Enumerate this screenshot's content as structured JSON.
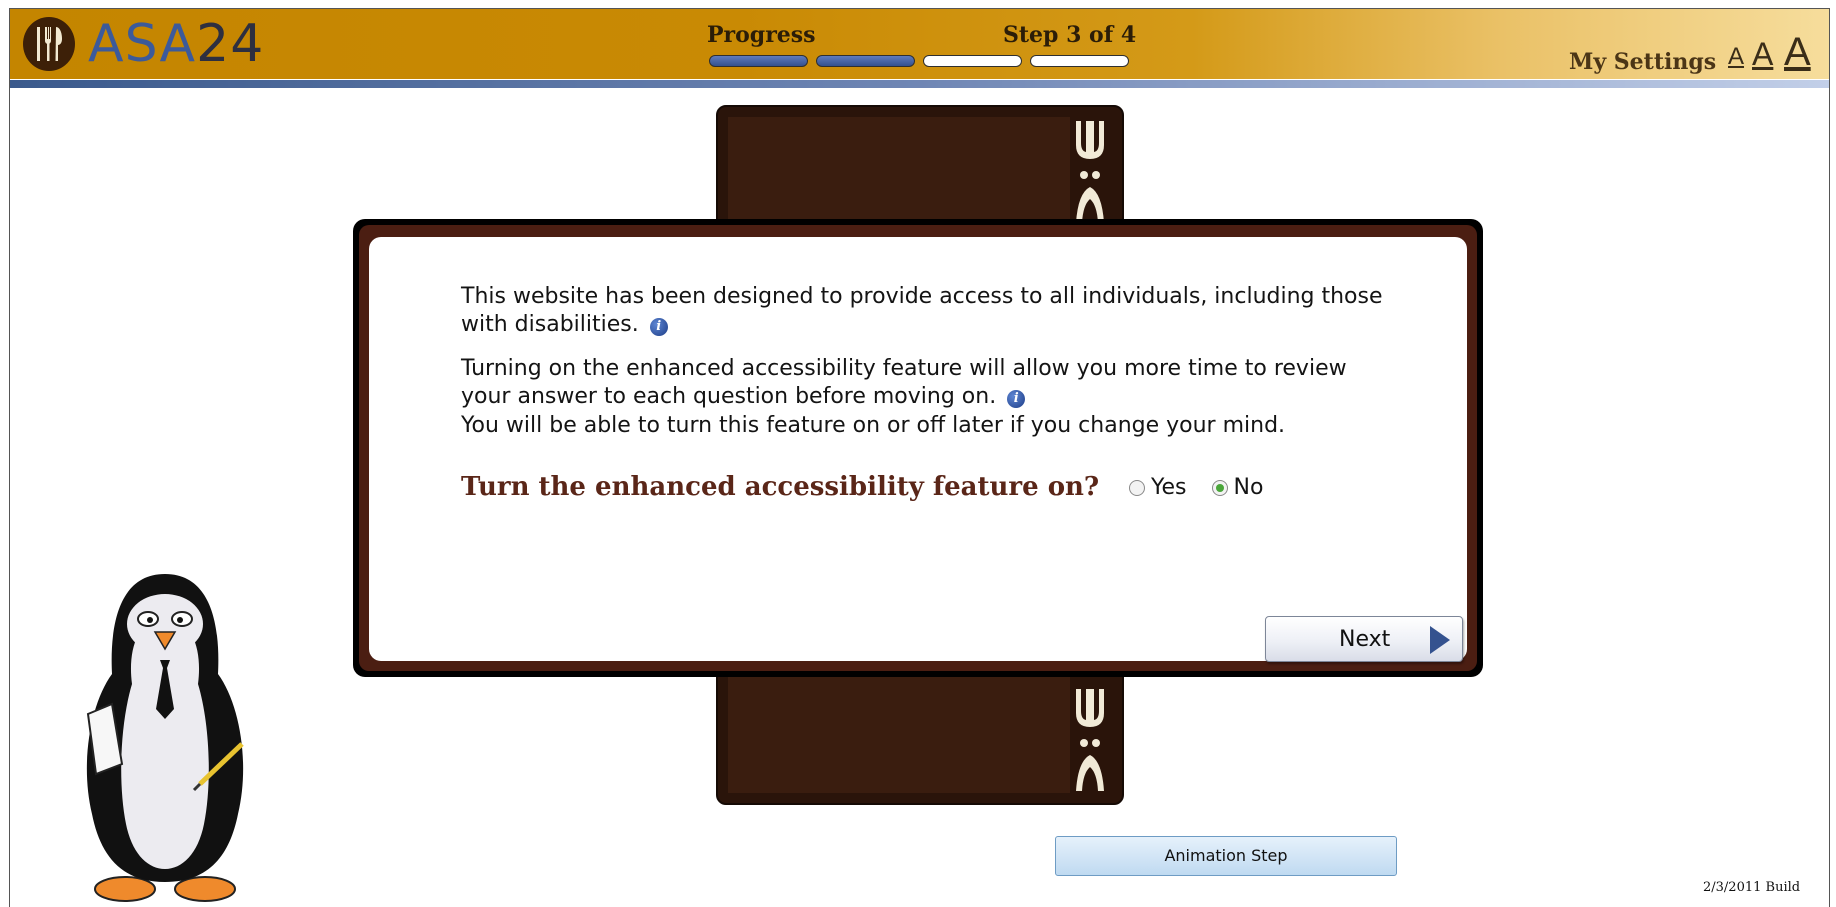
{
  "header": {
    "logo_letters": "ASA",
    "logo_number": "24",
    "progress_label": "Progress",
    "step_label": "Step 3 of 4",
    "progress": {
      "completed_steps": 2,
      "total_steps": 4
    },
    "my_settings_label": "My Settings",
    "font_size_options": [
      "A",
      "A",
      "A"
    ]
  },
  "dialog": {
    "paragraph1": "This website has been designed to provide access to all individuals, including those with disabilities.",
    "paragraph2": "Turning on the enhanced accessibility feature will allow you more time to review your answer to each question before moving on.",
    "paragraph3": "You will be able to turn this feature on or off later if you change your mind.",
    "question": "Turn the enhanced accessibility feature on?",
    "options": [
      {
        "label": "Yes",
        "selected": false
      },
      {
        "label": "No",
        "selected": true
      }
    ],
    "next_label": "Next"
  },
  "animation_button_label": "Animation Step",
  "build_label": "2/3/2011 Build",
  "colors": {
    "header_gold": "#c48500",
    "stripe_blue": "#3b5a8c",
    "placemat_brown": "#2a140a",
    "question_brown": "#5a2618",
    "radio_selected": "#4aa63a"
  },
  "icons": [
    "logo-utensils-icon",
    "info-icon",
    "next-arrow-icon",
    "penguin-waiter-mascot",
    "fork-ornament-icon"
  ]
}
